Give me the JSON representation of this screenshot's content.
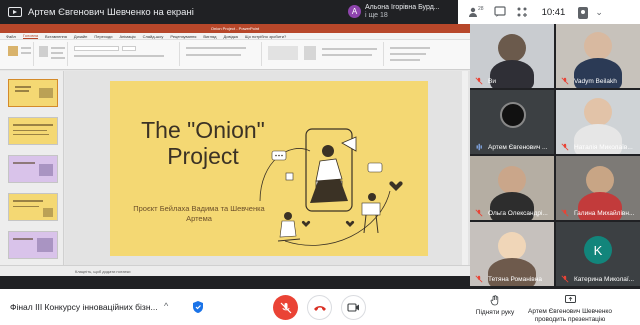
{
  "topbar": {
    "presenter_title": "Артем Євгенович Шевченко на екрані",
    "notification": {
      "avatar_letter": "А",
      "name": "Альона Ігорівна Бурд...",
      "more": "і ще 18"
    },
    "tray": {
      "badge": "28",
      "clock": "10:41"
    }
  },
  "ppt": {
    "window_title": "Onion Project - PowerPoint",
    "tabs": [
      "Файл",
      "Головна",
      "Вставлення",
      "Дизайн",
      "Переходи",
      "Анімація",
      "Слайд-шоу",
      "Рецензування",
      "Вигляд",
      "Довідка",
      "Що потрібно зробити?"
    ],
    "status": "Клацніть, щоб додати нотатки",
    "slide": {
      "title": "The \"Onion\" Project",
      "subtitle": "Проєкт Бейлаха Вадима та Шевченка Артема"
    }
  },
  "participants": [
    {
      "name": "Ви"
    },
    {
      "name": "Vadym Beilakh"
    },
    {
      "name": "Артем Євгенович ..."
    },
    {
      "name": "Наталія Миколаїв..."
    },
    {
      "name": "Ольга Олександрі..."
    },
    {
      "name": "Галина Михайлівн..."
    },
    {
      "name": "Тетяна Романівна"
    },
    {
      "name": "Катерина Миколаї...",
      "initial": "K"
    }
  ],
  "bottombar": {
    "meeting_name": "Фінал III Конкурсу інноваційних бізн...",
    "raise_hand": "Підняти руку",
    "presenting": "Артем Євгенович Шевченко проводить презентацію"
  },
  "colors": {
    "slide_bg": "#f4d873",
    "slide_text": "#3b3225",
    "ppt_accent": "#b7472a",
    "end_call": "#d93025",
    "mic_off": "#ea4335",
    "avatar_teal": "#12857b"
  }
}
